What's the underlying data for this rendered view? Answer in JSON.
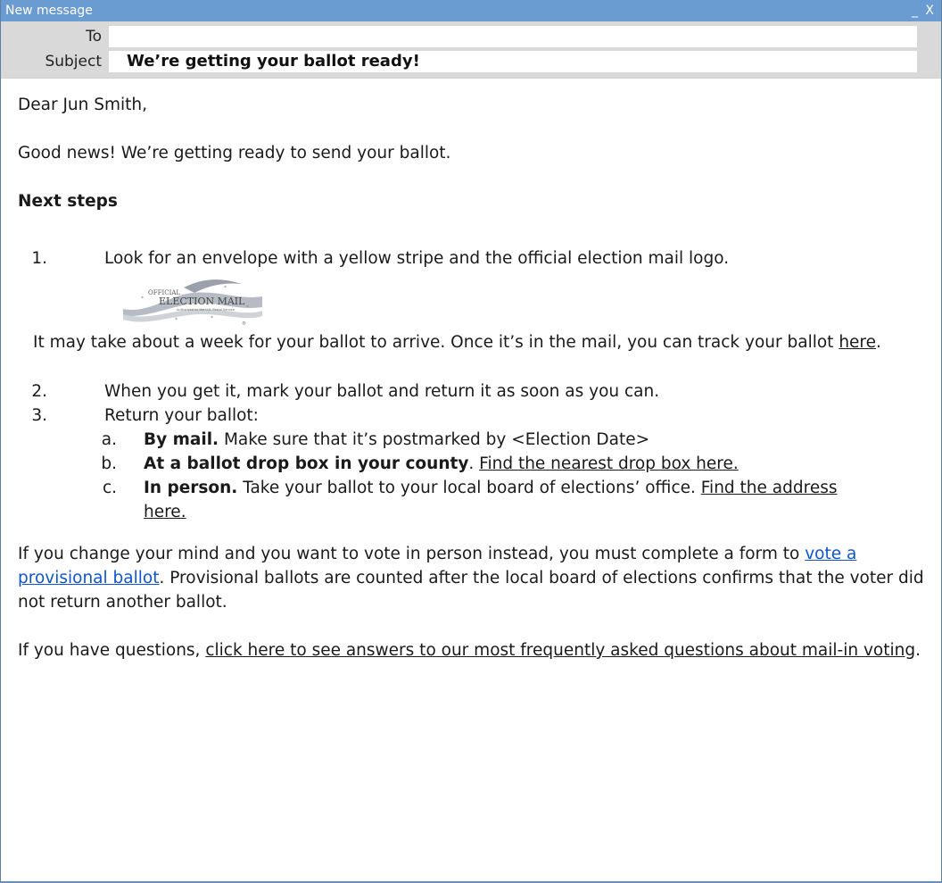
{
  "window": {
    "title": "New message",
    "minimize": "_",
    "close": "X"
  },
  "header": {
    "to_label": "To",
    "to_value": "",
    "subject_label": "Subject",
    "subject_value": "We’re getting your ballot ready!"
  },
  "email": {
    "greeting": "Dear Jun Smith,",
    "intro": "Good news! We’re getting ready to send your ballot.",
    "next_steps_heading": "Next steps",
    "step1_num": "1.",
    "step1_text": "Look for an envelope with a yellow stripe and the official election mail logo.",
    "logo": {
      "line1": "OFFICIAL",
      "line2": "ELECTION MAIL",
      "line3": "Authorized by the U.S. Postal Service",
      "reg": "®"
    },
    "step1_note_pre": "It may take about a week for your ballot to arrive.  Once it’s in the mail, you can track your ballot ",
    "step1_note_link": "here",
    "step1_note_post": ".",
    "step2_num": "2.",
    "step2_text": "When you get it, mark your ballot and return it as soon as you can.",
    "step3_num": "3.",
    "step3_text": "Return your ballot:",
    "sub_a_num": "a.",
    "sub_a_bold": "By mail.",
    "sub_a_text": " Make sure that it’s postmarked by <Election Date>",
    "sub_b_num": "b.",
    "sub_b_bold": "At a ballot drop box in your county",
    "sub_b_text": ". ",
    "sub_b_link": "Find the nearest drop box here.",
    "sub_c_num": "c.",
    "sub_c_bold": "In person.",
    "sub_c_text": " Take your ballot to your local board of elections’ office. ",
    "sub_c_link": "Find the address here.",
    "provisional_pre": "If you change your mind and you want to vote in person instead, you must complete a form to ",
    "provisional_link": "vote a provisional ballot",
    "provisional_post": ". Provisional ballots are counted after the local board of elections confirms that the voter did not return another ballot.",
    "questions_pre": "If you have questions, ",
    "questions_link": "click here to see answers to our most frequently asked questions about mail-in voting",
    "questions_post": "."
  },
  "colors": {
    "titlebar": "#6a9bd1",
    "header_bg": "#d9d9d9",
    "link_blue": "#1155cc"
  }
}
